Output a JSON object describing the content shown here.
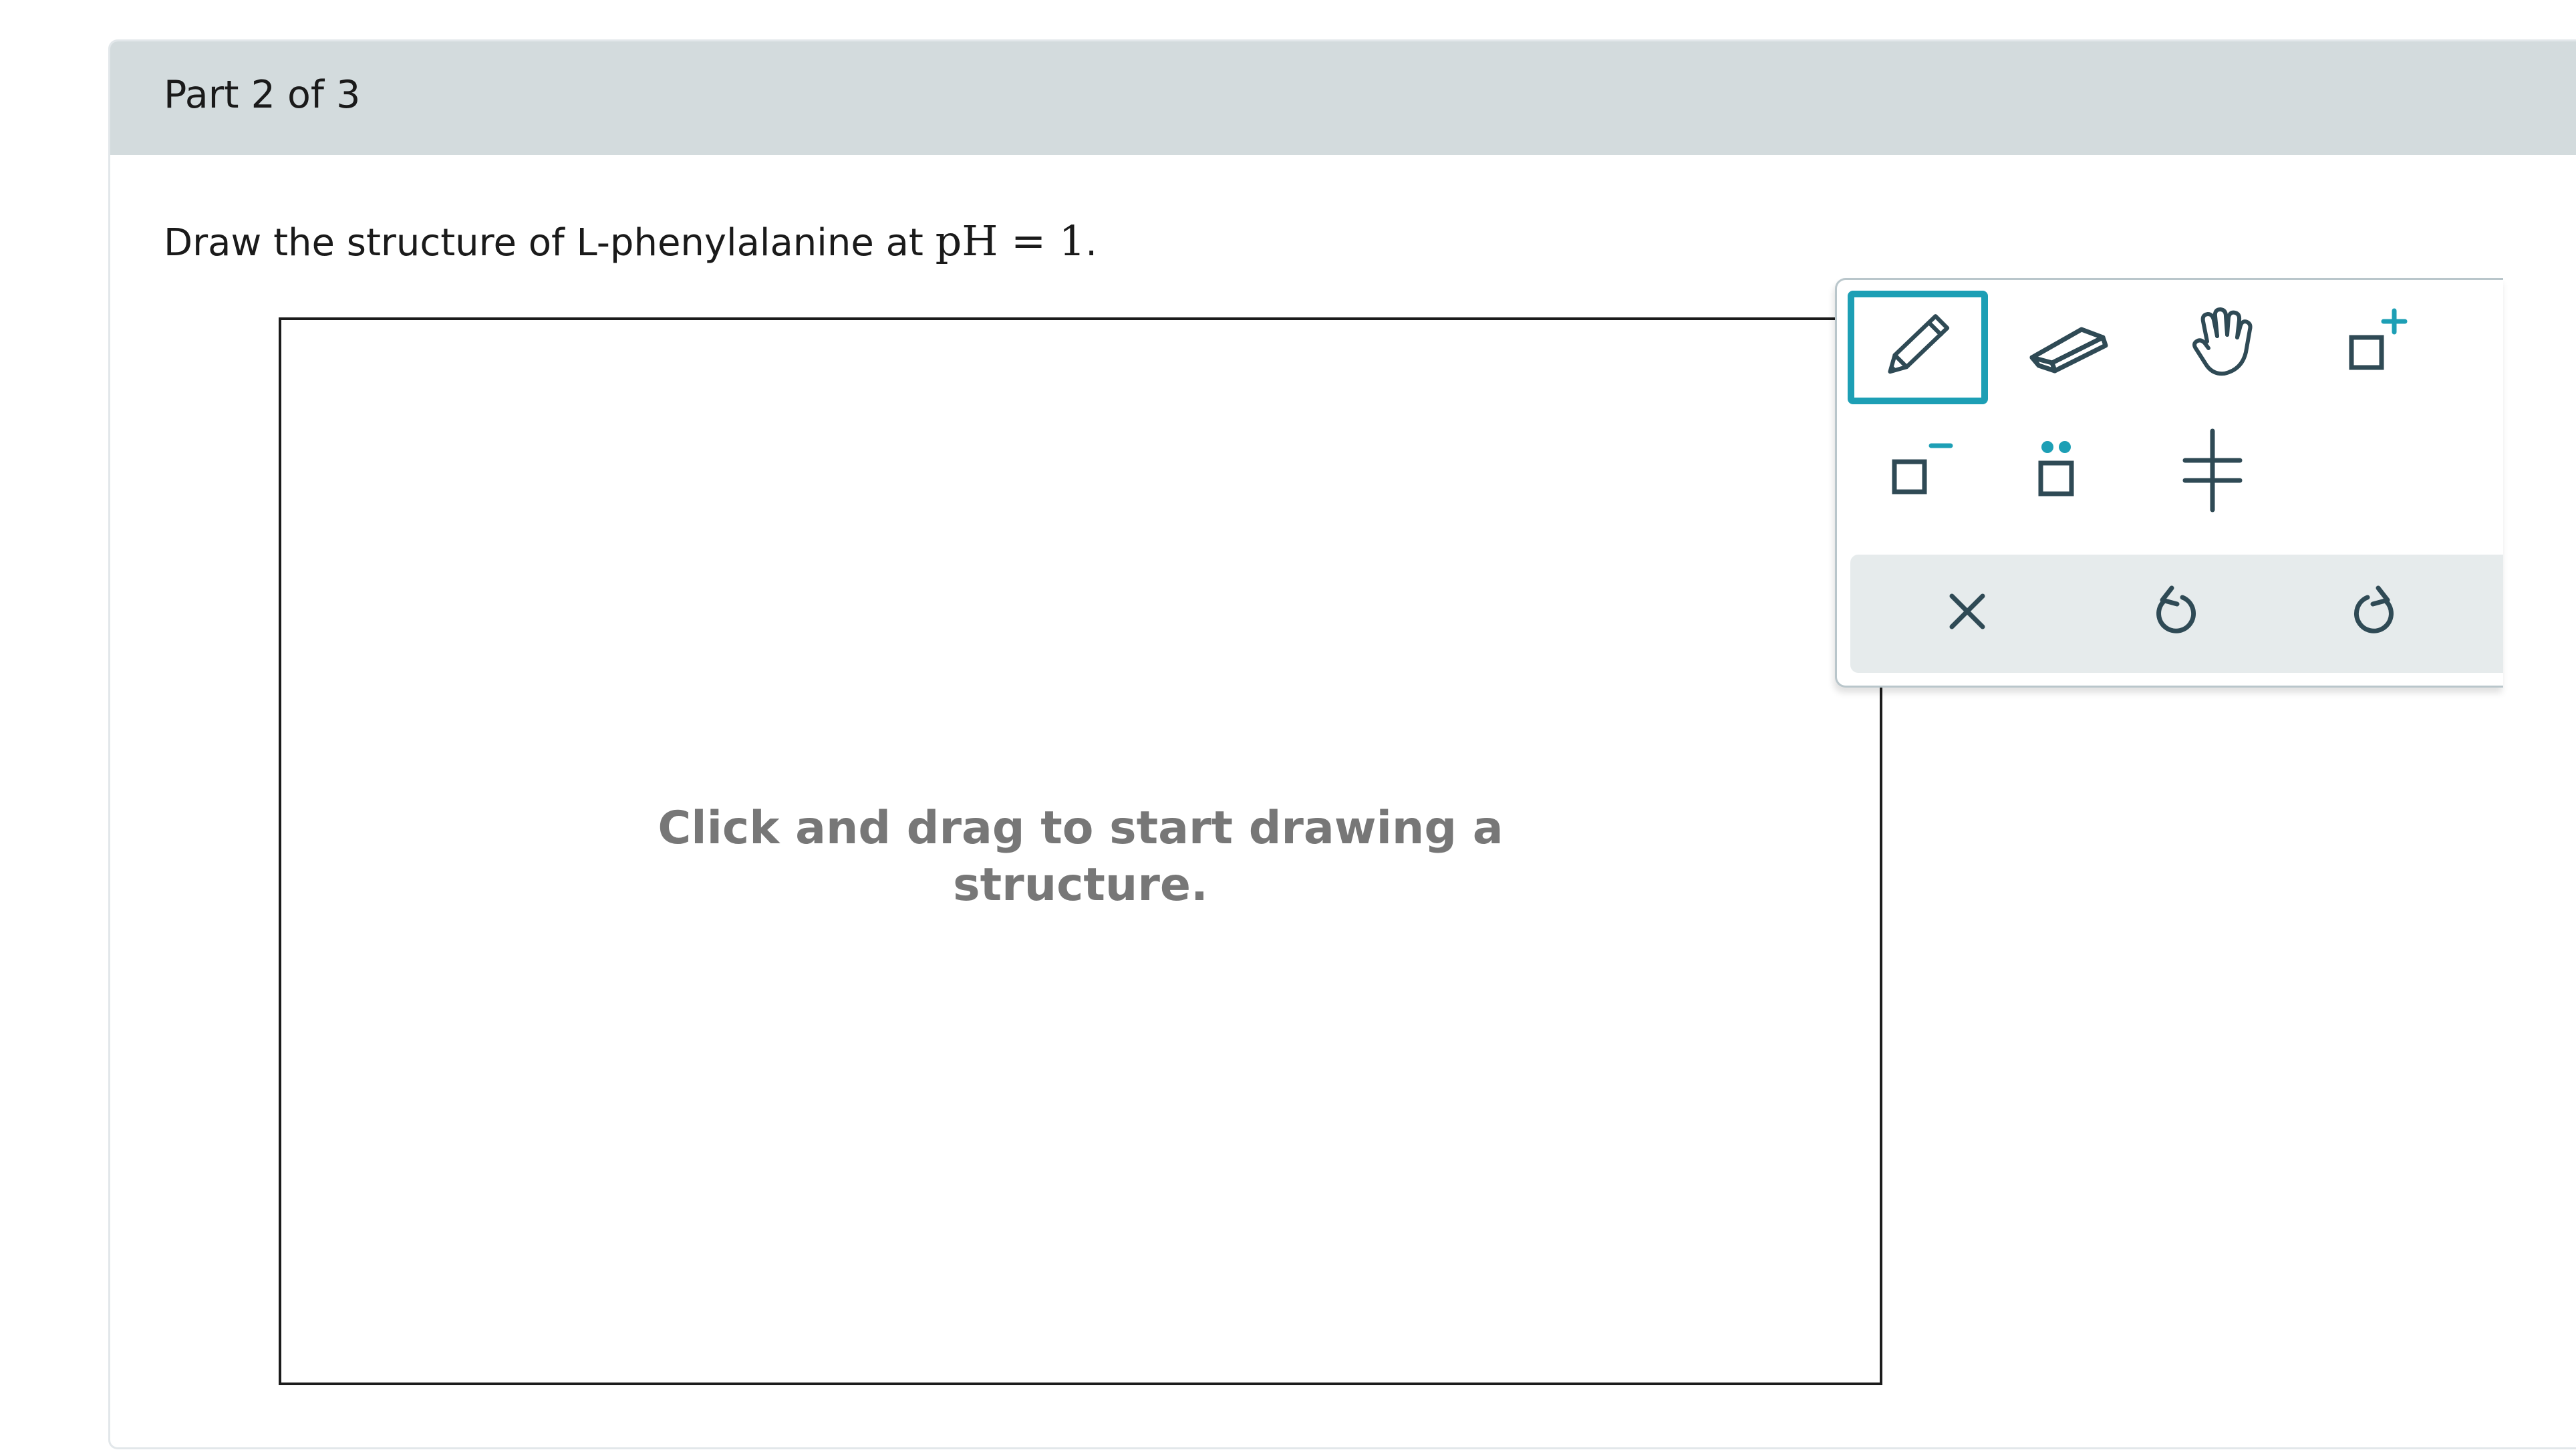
{
  "part": {
    "title": "Part 2 of 3"
  },
  "question": {
    "prompt_text": "Draw the structure of L-phenylalanine at ",
    "math": "pH = 1",
    "end_punct": "."
  },
  "canvas": {
    "hint_line1": "Click and drag to start drawing a",
    "hint_line2": "structure."
  },
  "toolbar": {
    "tools": [
      {
        "name": "pencil-icon",
        "selected": true
      },
      {
        "name": "eraser-icon",
        "selected": false
      },
      {
        "name": "hand-icon",
        "selected": false
      },
      {
        "name": "positive-charge-icon",
        "selected": false
      },
      {
        "name": "negative-charge-icon",
        "selected": false
      },
      {
        "name": "lone-pair-icon",
        "selected": false
      },
      {
        "name": "stereo-bond-icon",
        "selected": false
      }
    ],
    "actions": [
      {
        "name": "clear-icon"
      },
      {
        "name": "undo-icon"
      },
      {
        "name": "redo-icon"
      }
    ]
  },
  "colors": {
    "accent": "#1d9fb5",
    "icon": "#2f4a55",
    "header_bg": "#d3dbdd",
    "hint_text": "#777777"
  }
}
